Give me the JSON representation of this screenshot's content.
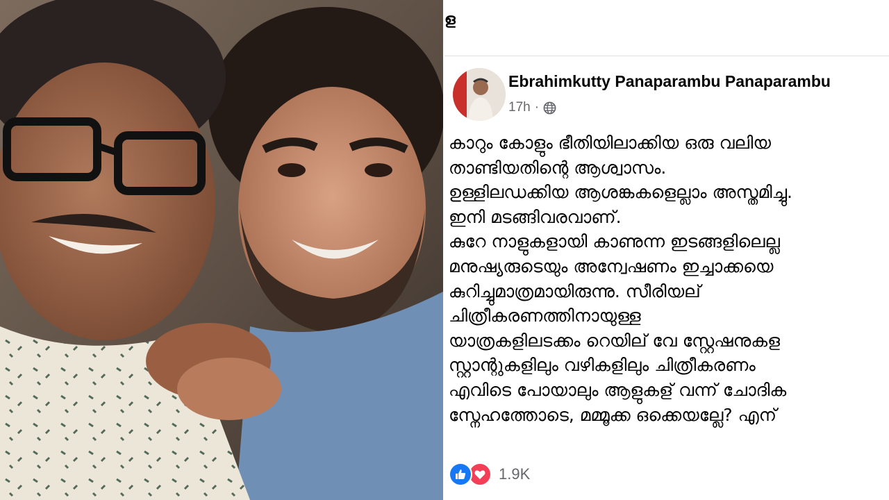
{
  "photo": {
    "description_icon": "photo-icon"
  },
  "post": {
    "header_fragment": "ള",
    "author": "Ebrahimkutty Panaparambu Panaparambu",
    "time": "17h",
    "dot": "·",
    "privacy_icon": "globe-icon",
    "body_lines": [
      "കാറും കോളും ഭീതിയിലാക്കിയ ഒരു വലിയ",
      "താണ്ടിയതിന്റെ ആശ്വാസം.",
      "ഉള്ളിലഡക്കിയ ആശങ്കകളെല്ലാം അസ്തമിച്ചു.",
      "ഇനി മടങ്ങിവരവാണ്.",
      "കുറേ നാളുകളായി കാണുന്ന ഇടങ്ങളിലെല്ല",
      "മനുഷ്യരുടെയും അന്വേഷണം ഇച്ചാക്കയെ",
      "കുറിച്ചുമാത്രമായിരുന്നു. സീരിയല്",
      "ചിത്രീകരണത്തിനായുള്ള",
      "യാത്രകളിലടക്കം റെയില് വേ സ്റ്റേഷനുകള",
      "സ്റ്റാന്റുകളിലും വഴികളിലും ചിത്രീകരണം",
      "എവിടെ പോയാലും ആളുകള് വന്ന് ചോദിക",
      "സ്നേഹത്തോടെ, മമ്മൂക്ക ഒക്കെയല്ലേ? എന്"
    ],
    "reactions": {
      "like_icon": "like-icon",
      "love_icon": "love-icon",
      "count": "1.9K"
    }
  }
}
